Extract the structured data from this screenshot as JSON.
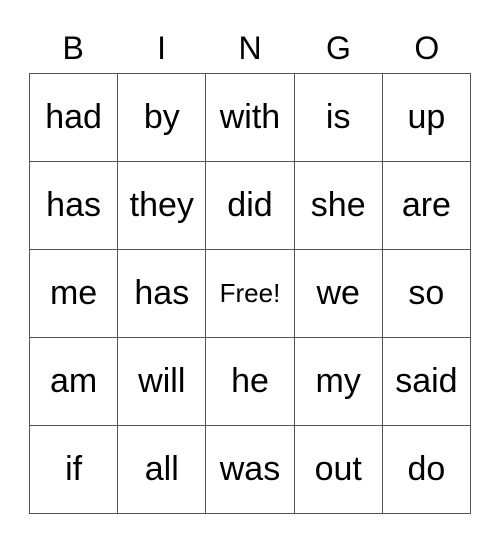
{
  "header": [
    "B",
    "I",
    "N",
    "G",
    "O"
  ],
  "rows": [
    [
      "had",
      "by",
      "with",
      "is",
      "up"
    ],
    [
      "has",
      "they",
      "did",
      "she",
      "are"
    ],
    [
      "me",
      "has",
      "Free!",
      "we",
      "so"
    ],
    [
      "am",
      "will",
      "he",
      "my",
      "said"
    ],
    [
      "if",
      "all",
      "was",
      "out",
      "do"
    ]
  ]
}
